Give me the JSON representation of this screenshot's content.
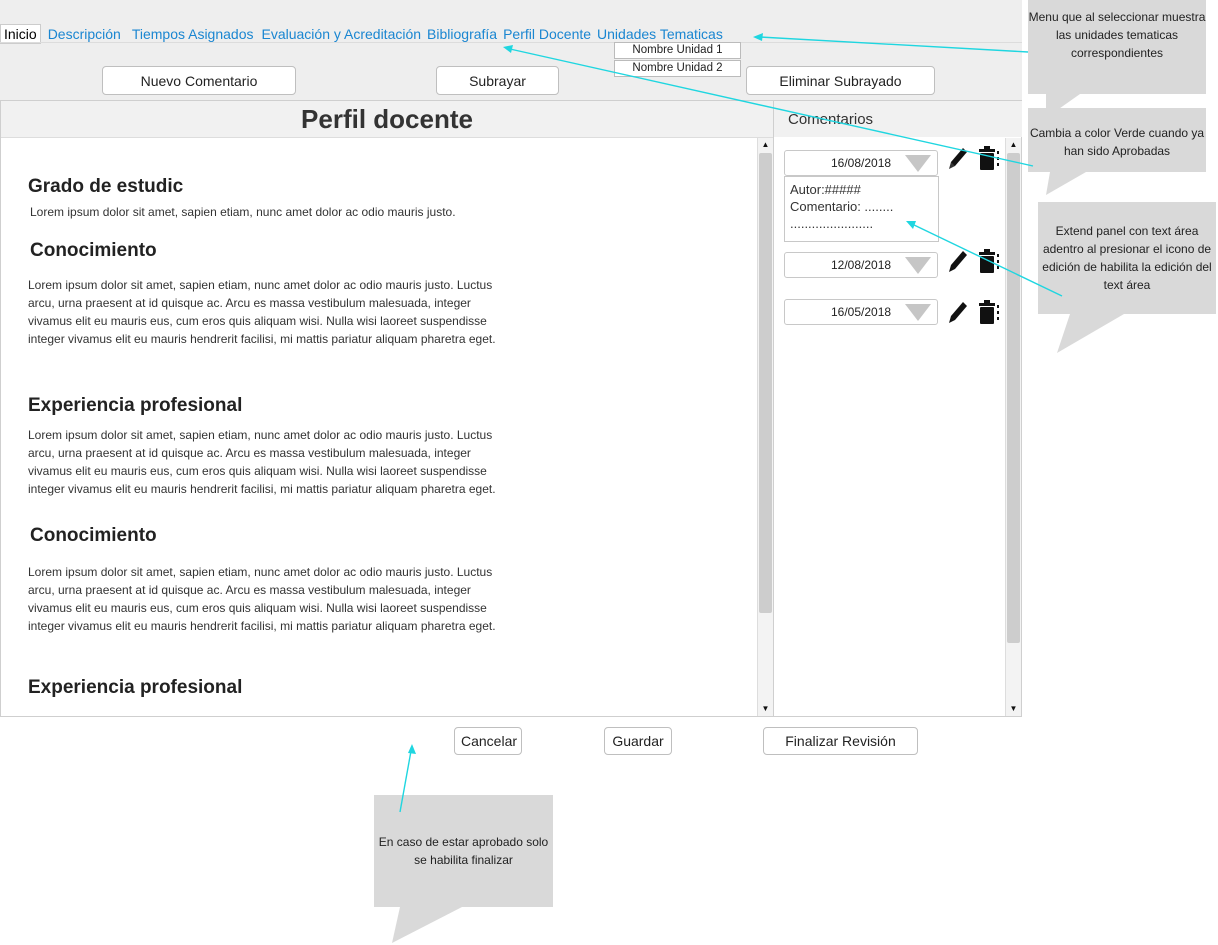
{
  "menu": {
    "items": [
      "Inicio",
      "Descripción",
      "Tiempos Asignados",
      "Evaluación y Acreditación",
      "Bibliografía",
      "Perfil Docente",
      "Unidades Tematicas"
    ],
    "submenu": [
      "Nombre Unidad 1",
      "Nombre Unidad 2"
    ]
  },
  "toolbar": {
    "new_comment": "Nuevo Comentario",
    "underline": "Subrayar",
    "remove_underline": "Eliminar Subrayado"
  },
  "main": {
    "title": "Perfil docente",
    "sections": [
      {
        "heading": "Grado de estudic",
        "body": "Lorem ipsum dolor sit amet, sapien etiam, nunc amet dolor ac odio mauris justo."
      },
      {
        "heading": "Conocimiento",
        "body": "Lorem ipsum dolor sit amet, sapien etiam, nunc amet dolor ac odio mauris justo. Luctus arcu, urna praesent at id quisque ac. Arcu es massa vestibulum malesuada, integer vivamus elit eu mauris eus, cum eros quis aliquam wisi. Nulla wisi laoreet suspendisse integer vivamus elit eu mauris hendrerit facilisi, mi mattis pariatur aliquam pharetra eget."
      },
      {
        "heading": "Experiencia profesional",
        "body": "Lorem ipsum dolor sit amet, sapien etiam, nunc amet dolor ac odio mauris justo. Luctus arcu, urna praesent at id quisque ac. Arcu es massa vestibulum malesuada, integer vivamus elit eu mauris eus, cum eros quis aliquam wisi. Nulla wisi laoreet suspendisse integer vivamus elit eu mauris hendrerit facilisi, mi mattis pariatur aliquam pharetra eget."
      },
      {
        "heading": "Conocimiento",
        "body": "Lorem ipsum dolor sit amet, sapien etiam, nunc amet dolor ac odio mauris justo. Luctus arcu, urna praesent at id quisque ac. Arcu es massa vestibulum malesuada, integer vivamus elit eu mauris eus, cum eros quis aliquam wisi. Nulla wisi laoreet suspendisse integer vivamus elit eu mauris hendrerit facilisi, mi mattis pariatur aliquam pharetra eget."
      },
      {
        "heading": "Experiencia profesional",
        "body": ""
      }
    ]
  },
  "comments": {
    "title": "Comentarios",
    "items": [
      {
        "date": "16/08/2018",
        "text": "Autor:#####\nComentario: ........\n......................."
      },
      {
        "date": "12/08/2018"
      },
      {
        "date": "16/05/2018"
      }
    ]
  },
  "footer": {
    "cancel": "Cancelar",
    "save": "Guardar",
    "finish": "Finalizar Revisión"
  },
  "notes": {
    "menu_note": "Menu que al seleccionar muestra las unidades tematicas correspondientes",
    "approved_note": "Cambia a color Verde cuando ya han sido Aprobadas",
    "extend_note": "Extend panel con text área adentro al presionar el icono de edición de habilita la edición del text área",
    "finalize_note": "En caso de estar aprobado solo se habilita finalizar"
  },
  "colors": {
    "link": "#1a86d1",
    "callout_line": "#1fd6e0",
    "note_bg": "#d9d9d9"
  }
}
